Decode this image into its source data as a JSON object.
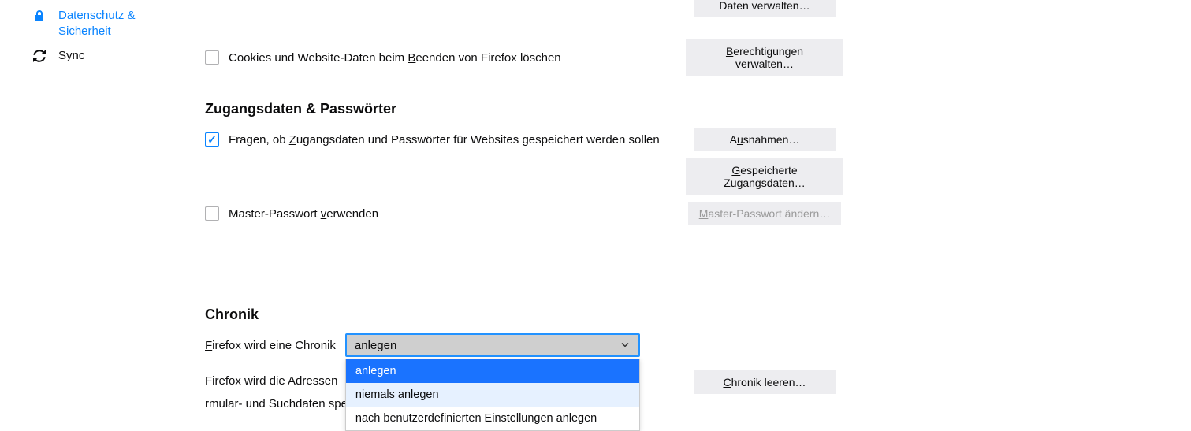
{
  "sidebar": {
    "privacy": {
      "label": "Datenschutz & Sicherheit"
    },
    "sync": {
      "label": "Sync"
    }
  },
  "cookies": {
    "delete_on_close": "Cookies und Website-Daten beim ",
    "delete_on_close_key": "B",
    "delete_on_close_suffix": "eenden von Firefox löschen",
    "manage_data_btn": "Daten verwalten…",
    "permissions_btn_pre": "B",
    "permissions_btn_suffix": "erechtigungen verwalten…"
  },
  "logins": {
    "heading": "Zugangsdaten & Passwörter",
    "ask_save_pre": "Fragen, ob ",
    "ask_save_key": "Z",
    "ask_save_suffix": "ugangsdaten und Passwörter für Websites gespeichert werden sollen",
    "exceptions_btn_pre": "A",
    "exceptions_btn_key": "u",
    "exceptions_btn_suffix": "snahmen…",
    "saved_btn_pre": "G",
    "saved_btn_suffix": "espeicherte Zugangsdaten…",
    "master_pw": "Master-Passwort ",
    "master_pw_key": "v",
    "master_pw_suffix": "erwenden",
    "master_change_btn_pre": "M",
    "master_change_btn_suffix": "aster-Passwort ändern…"
  },
  "history": {
    "heading": "Chronik",
    "label_pre": "F",
    "label_suffix": "irefox wird eine Chronik",
    "select_current": "anlegen",
    "options": {
      "always": "anlegen",
      "never": "niemals anlegen",
      "custom": "nach benutzerdefinierten Einstellungen anlegen"
    },
    "desc_part1": "Firefox wird die Adressen",
    "desc_part2": "rmular- und Suchdaten speichern.",
    "clear_btn_pre": "C",
    "clear_btn_suffix": "hronik leeren…"
  }
}
